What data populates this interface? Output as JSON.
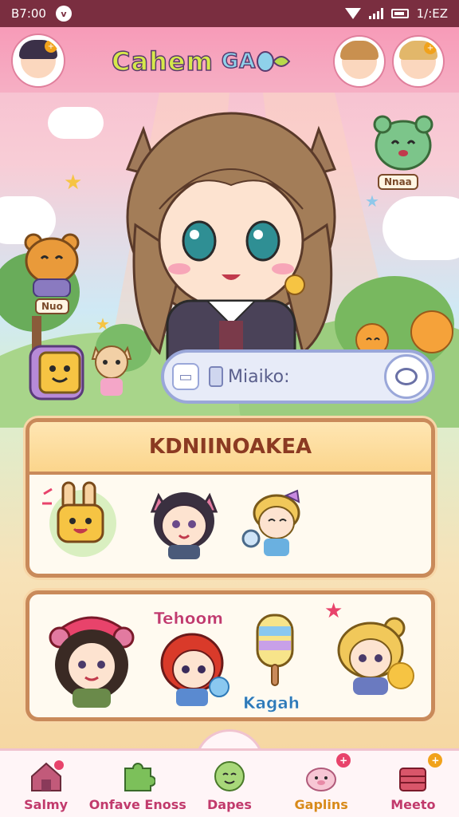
{
  "status_bar": {
    "time": "B7:00",
    "right_text": "1/:EZ"
  },
  "header": {
    "title_part1": "Cahem",
    "title_part2": "GA",
    "left_avatar_badge": "+",
    "right_avatar_badge": "+"
  },
  "scene": {
    "tag_right": "Nnaa",
    "tag_left": "Nuo"
  },
  "search": {
    "placeholder": "Miaiko:"
  },
  "panel1": {
    "title": "KDNIINOAKEA"
  },
  "panel2": {
    "label_top": "Tehoom",
    "label_bottom": "Kagah"
  },
  "bottom_nav": {
    "items": [
      {
        "label": "Salmy",
        "color": "#c13a6c"
      },
      {
        "label": "Onfave Enoss",
        "color": "#c13a6c"
      },
      {
        "label": "Dapes",
        "color": "#c13a6c"
      },
      {
        "label": "Gaplins",
        "color": "#d88a1a"
      },
      {
        "label": "Meeto",
        "color": "#c13a6c"
      }
    ]
  },
  "colors": {
    "accent_pink": "#f79bb8",
    "panel_border": "#c98a5a",
    "status_bar": "#7a2e40"
  }
}
